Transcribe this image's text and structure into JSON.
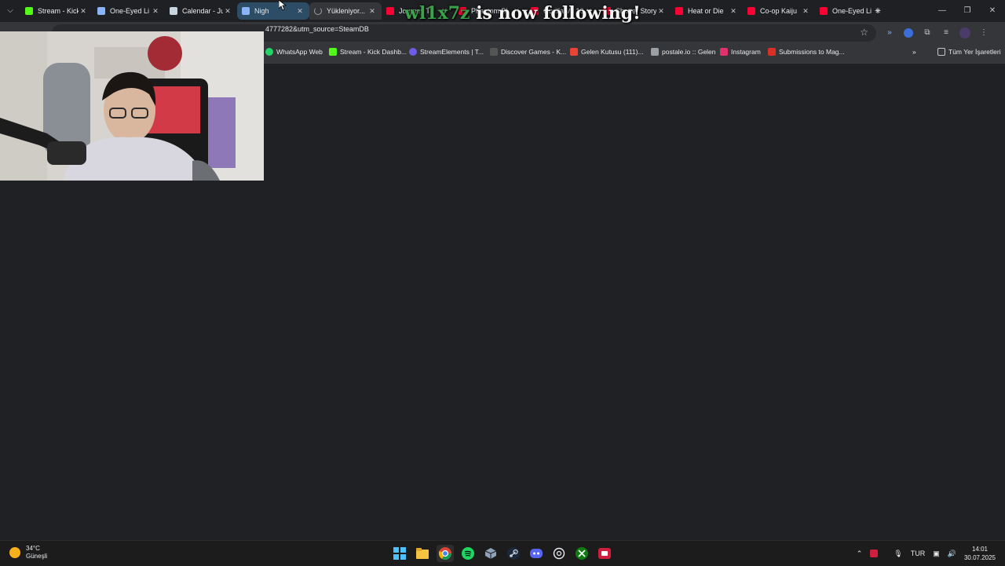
{
  "tabs": [
    {
      "title": "Stream - Kick",
      "color": "#53fc18"
    },
    {
      "title": "One-Eyed Li",
      "color": "#c7d5e0"
    },
    {
      "title": "Calendar - Ju",
      "color": "#c7d5e0"
    },
    {
      "title": "Nigh",
      "color": "#8ab4f8"
    },
    {
      "title": "Yükleniyor...",
      "color": "#9aa0a6"
    },
    {
      "title": "Journey Th",
      "color": "#ff0033"
    },
    {
      "title": "Phantom Bl",
      "color": "#ff0033"
    },
    {
      "title": "Gorilla Vs 10",
      "color": "#ff0033"
    },
    {
      "title": "Shutter Story",
      "color": "#ff0033"
    },
    {
      "title": "Heat or Die",
      "color": "#ff0033"
    },
    {
      "title": "Co-op Kaiju",
      "color": "#ff0033"
    },
    {
      "title": "One-Eyed Li",
      "color": "#ff0033"
    }
  ],
  "address": {
    "url": "4777282&utm_source=SteamDB"
  },
  "bookmarks": [
    {
      "label": "WhatsApp Web",
      "color": "#25d366"
    },
    {
      "label": "Stream - Kick Dashb...",
      "color": "#53fc18"
    },
    {
      "label": "StreamElements | T...",
      "color": "#6c5ce7"
    },
    {
      "label": "Discover Games - K...",
      "color": "#e8eaed"
    },
    {
      "label": "Gelen Kutusu (111)...",
      "color": "#ea4335"
    },
    {
      "label": "postale.io :: Gelen",
      "color": "#9aa0a6"
    },
    {
      "label": "Instagram",
      "color": "#e1306c"
    },
    {
      "label": "Submissions to Mag...",
      "color": "#d93025"
    }
  ],
  "bookmarks_all": "Tüm Yer İşaretleri",
  "alert": {
    "username": "wl1x7z",
    "message": "is now following!"
  },
  "weather": {
    "temp": "34°C",
    "condition": "Güneşli"
  },
  "tray": {
    "language": "TUR"
  },
  "clock": {
    "time": "14:01",
    "date": "30.07.2025"
  }
}
